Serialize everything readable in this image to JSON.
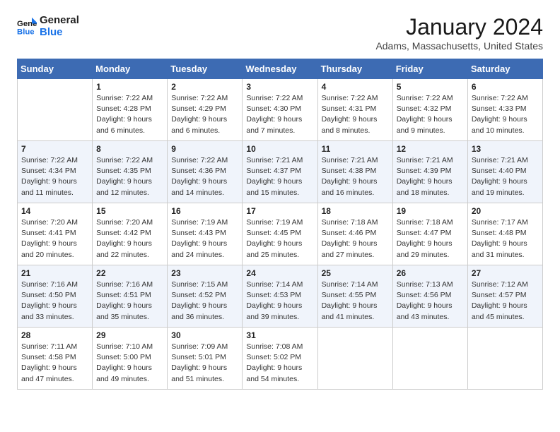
{
  "header": {
    "logo_line1": "General",
    "logo_line2": "Blue",
    "month": "January 2024",
    "location": "Adams, Massachusetts, United States"
  },
  "weekdays": [
    "Sunday",
    "Monday",
    "Tuesday",
    "Wednesday",
    "Thursday",
    "Friday",
    "Saturday"
  ],
  "weeks": [
    [
      {
        "day": "",
        "sunrise": "",
        "sunset": "",
        "daylight": ""
      },
      {
        "day": "1",
        "sunrise": "Sunrise: 7:22 AM",
        "sunset": "Sunset: 4:28 PM",
        "daylight": "Daylight: 9 hours and 6 minutes."
      },
      {
        "day": "2",
        "sunrise": "Sunrise: 7:22 AM",
        "sunset": "Sunset: 4:29 PM",
        "daylight": "Daylight: 9 hours and 6 minutes."
      },
      {
        "day": "3",
        "sunrise": "Sunrise: 7:22 AM",
        "sunset": "Sunset: 4:30 PM",
        "daylight": "Daylight: 9 hours and 7 minutes."
      },
      {
        "day": "4",
        "sunrise": "Sunrise: 7:22 AM",
        "sunset": "Sunset: 4:31 PM",
        "daylight": "Daylight: 9 hours and 8 minutes."
      },
      {
        "day": "5",
        "sunrise": "Sunrise: 7:22 AM",
        "sunset": "Sunset: 4:32 PM",
        "daylight": "Daylight: 9 hours and 9 minutes."
      },
      {
        "day": "6",
        "sunrise": "Sunrise: 7:22 AM",
        "sunset": "Sunset: 4:33 PM",
        "daylight": "Daylight: 9 hours and 10 minutes."
      }
    ],
    [
      {
        "day": "7",
        "sunrise": "Sunrise: 7:22 AM",
        "sunset": "Sunset: 4:34 PM",
        "daylight": "Daylight: 9 hours and 11 minutes."
      },
      {
        "day": "8",
        "sunrise": "Sunrise: 7:22 AM",
        "sunset": "Sunset: 4:35 PM",
        "daylight": "Daylight: 9 hours and 12 minutes."
      },
      {
        "day": "9",
        "sunrise": "Sunrise: 7:22 AM",
        "sunset": "Sunset: 4:36 PM",
        "daylight": "Daylight: 9 hours and 14 minutes."
      },
      {
        "day": "10",
        "sunrise": "Sunrise: 7:21 AM",
        "sunset": "Sunset: 4:37 PM",
        "daylight": "Daylight: 9 hours and 15 minutes."
      },
      {
        "day": "11",
        "sunrise": "Sunrise: 7:21 AM",
        "sunset": "Sunset: 4:38 PM",
        "daylight": "Daylight: 9 hours and 16 minutes."
      },
      {
        "day": "12",
        "sunrise": "Sunrise: 7:21 AM",
        "sunset": "Sunset: 4:39 PM",
        "daylight": "Daylight: 9 hours and 18 minutes."
      },
      {
        "day": "13",
        "sunrise": "Sunrise: 7:21 AM",
        "sunset": "Sunset: 4:40 PM",
        "daylight": "Daylight: 9 hours and 19 minutes."
      }
    ],
    [
      {
        "day": "14",
        "sunrise": "Sunrise: 7:20 AM",
        "sunset": "Sunset: 4:41 PM",
        "daylight": "Daylight: 9 hours and 20 minutes."
      },
      {
        "day": "15",
        "sunrise": "Sunrise: 7:20 AM",
        "sunset": "Sunset: 4:42 PM",
        "daylight": "Daylight: 9 hours and 22 minutes."
      },
      {
        "day": "16",
        "sunrise": "Sunrise: 7:19 AM",
        "sunset": "Sunset: 4:43 PM",
        "daylight": "Daylight: 9 hours and 24 minutes."
      },
      {
        "day": "17",
        "sunrise": "Sunrise: 7:19 AM",
        "sunset": "Sunset: 4:45 PM",
        "daylight": "Daylight: 9 hours and 25 minutes."
      },
      {
        "day": "18",
        "sunrise": "Sunrise: 7:18 AM",
        "sunset": "Sunset: 4:46 PM",
        "daylight": "Daylight: 9 hours and 27 minutes."
      },
      {
        "day": "19",
        "sunrise": "Sunrise: 7:18 AM",
        "sunset": "Sunset: 4:47 PM",
        "daylight": "Daylight: 9 hours and 29 minutes."
      },
      {
        "day": "20",
        "sunrise": "Sunrise: 7:17 AM",
        "sunset": "Sunset: 4:48 PM",
        "daylight": "Daylight: 9 hours and 31 minutes."
      }
    ],
    [
      {
        "day": "21",
        "sunrise": "Sunrise: 7:16 AM",
        "sunset": "Sunset: 4:50 PM",
        "daylight": "Daylight: 9 hours and 33 minutes."
      },
      {
        "day": "22",
        "sunrise": "Sunrise: 7:16 AM",
        "sunset": "Sunset: 4:51 PM",
        "daylight": "Daylight: 9 hours and 35 minutes."
      },
      {
        "day": "23",
        "sunrise": "Sunrise: 7:15 AM",
        "sunset": "Sunset: 4:52 PM",
        "daylight": "Daylight: 9 hours and 36 minutes."
      },
      {
        "day": "24",
        "sunrise": "Sunrise: 7:14 AM",
        "sunset": "Sunset: 4:53 PM",
        "daylight": "Daylight: 9 hours and 39 minutes."
      },
      {
        "day": "25",
        "sunrise": "Sunrise: 7:14 AM",
        "sunset": "Sunset: 4:55 PM",
        "daylight": "Daylight: 9 hours and 41 minutes."
      },
      {
        "day": "26",
        "sunrise": "Sunrise: 7:13 AM",
        "sunset": "Sunset: 4:56 PM",
        "daylight": "Daylight: 9 hours and 43 minutes."
      },
      {
        "day": "27",
        "sunrise": "Sunrise: 7:12 AM",
        "sunset": "Sunset: 4:57 PM",
        "daylight": "Daylight: 9 hours and 45 minutes."
      }
    ],
    [
      {
        "day": "28",
        "sunrise": "Sunrise: 7:11 AM",
        "sunset": "Sunset: 4:58 PM",
        "daylight": "Daylight: 9 hours and 47 minutes."
      },
      {
        "day": "29",
        "sunrise": "Sunrise: 7:10 AM",
        "sunset": "Sunset: 5:00 PM",
        "daylight": "Daylight: 9 hours and 49 minutes."
      },
      {
        "day": "30",
        "sunrise": "Sunrise: 7:09 AM",
        "sunset": "Sunset: 5:01 PM",
        "daylight": "Daylight: 9 hours and 51 minutes."
      },
      {
        "day": "31",
        "sunrise": "Sunrise: 7:08 AM",
        "sunset": "Sunset: 5:02 PM",
        "daylight": "Daylight: 9 hours and 54 minutes."
      },
      {
        "day": "",
        "sunrise": "",
        "sunset": "",
        "daylight": ""
      },
      {
        "day": "",
        "sunrise": "",
        "sunset": "",
        "daylight": ""
      },
      {
        "day": "",
        "sunrise": "",
        "sunset": "",
        "daylight": ""
      }
    ]
  ]
}
